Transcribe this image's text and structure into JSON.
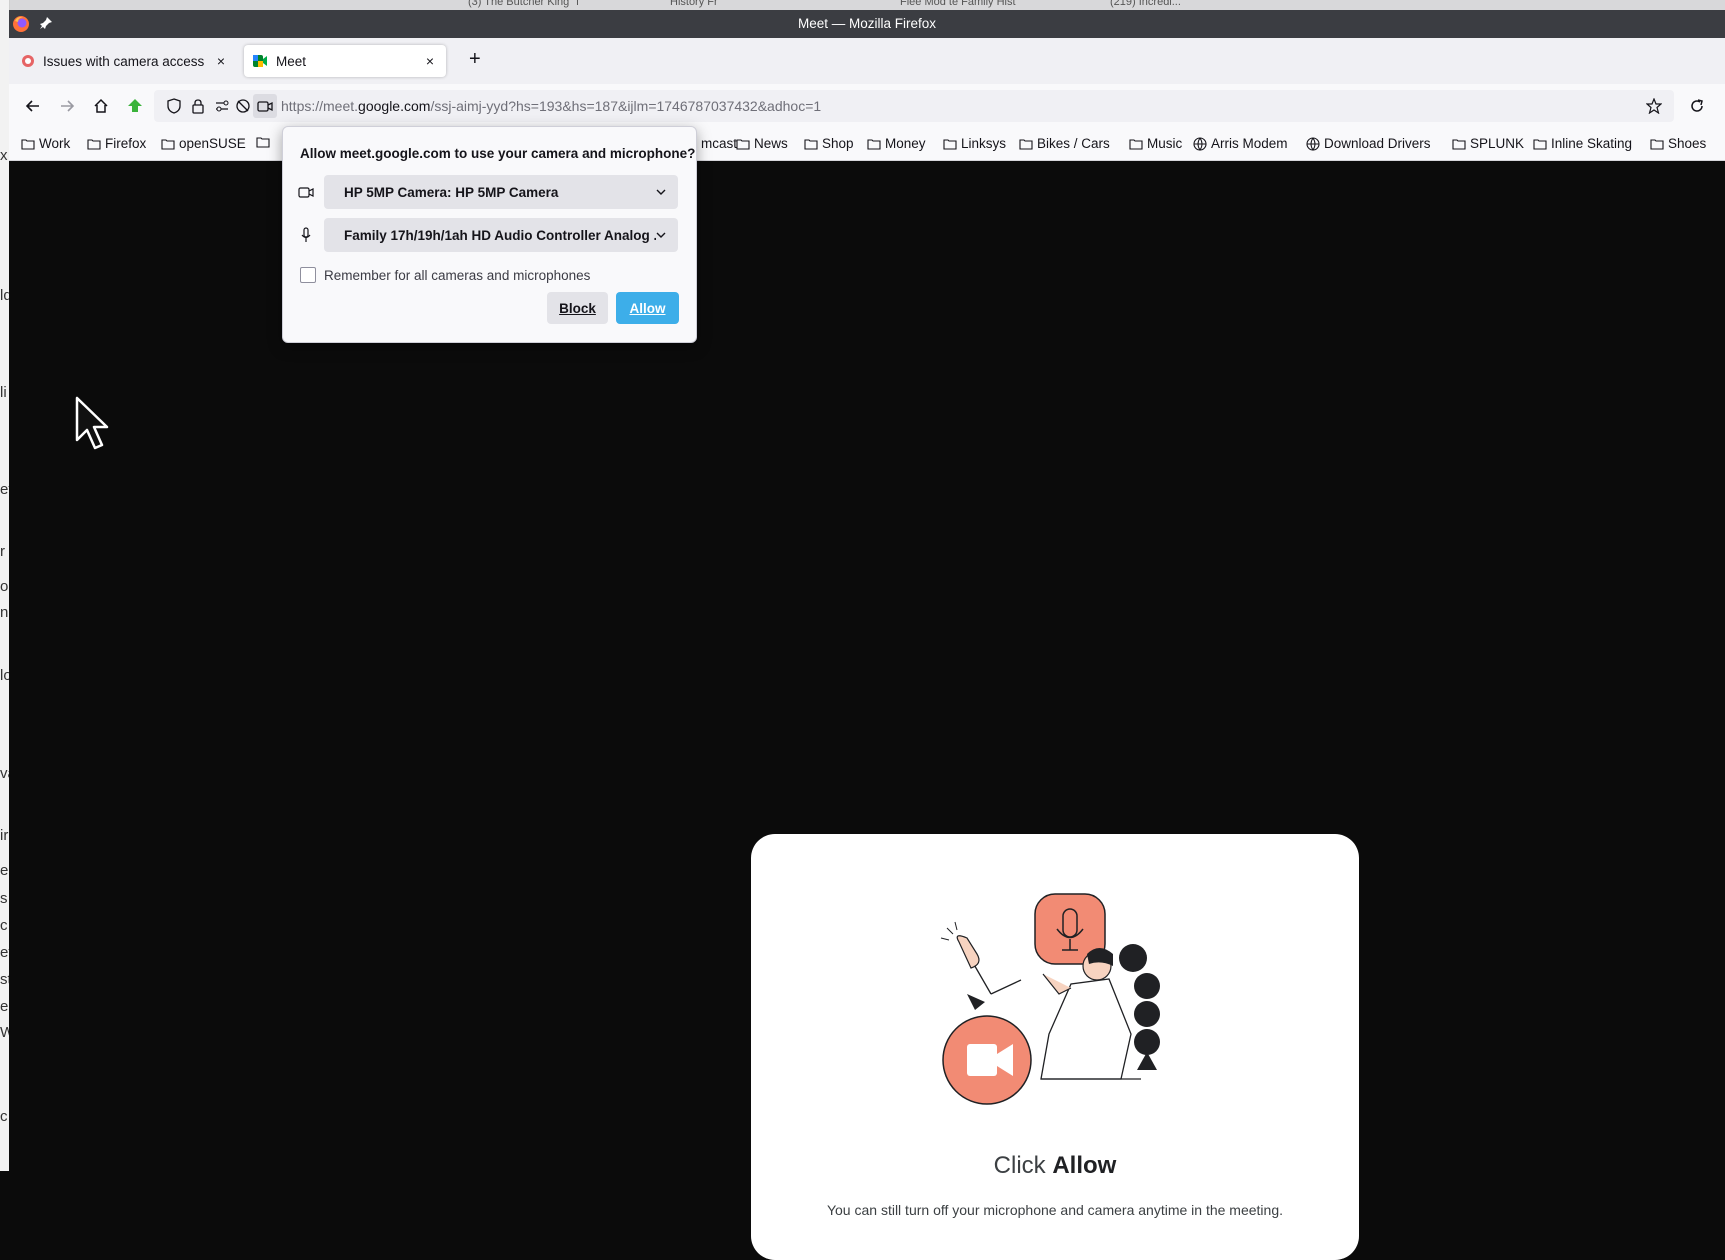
{
  "background_tabs": [
    {
      "label": "(3) The Butcher King \"i"
    },
    {
      "label": "History Fr"
    },
    {
      "label": "Flee Mod te Family Hist"
    },
    {
      "label": "(219) Incredi..."
    }
  ],
  "window": {
    "title": "Meet — Mozilla Firefox"
  },
  "tabs": [
    {
      "label": "Issues with camera access",
      "close": "×"
    },
    {
      "label": "Meet",
      "close": "×"
    }
  ],
  "new_tab": "+",
  "url": {
    "prefix": "https://meet.",
    "host": "google.com",
    "path": "/ssj-aimj-yyd?hs=193&hs=187&ijlm=1746787037432&adhoc=1"
  },
  "bookmarks": [
    {
      "label": "Work",
      "icon": "folder-icon"
    },
    {
      "label": "Firefox",
      "icon": "folder-icon"
    },
    {
      "label": "openSUSE",
      "icon": "folder-icon"
    },
    {
      "label": "mcast",
      "icon": "folder-icon"
    },
    {
      "label": "News",
      "icon": "folder-icon"
    },
    {
      "label": "Shop",
      "icon": "folder-icon"
    },
    {
      "label": "Money",
      "icon": "folder-icon"
    },
    {
      "label": "Linksys",
      "icon": "folder-icon"
    },
    {
      "label": "Bikes / Cars",
      "icon": "folder-icon"
    },
    {
      "label": "Music",
      "icon": "folder-icon"
    },
    {
      "label": "Arris Modem",
      "icon": "globe-icon"
    },
    {
      "label": "Download Drivers",
      "icon": "globe-icon"
    },
    {
      "label": "SPLUNK",
      "icon": "folder-icon"
    },
    {
      "label": "Inline Skating",
      "icon": "folder-icon"
    },
    {
      "label": "Shoes",
      "icon": "folder-icon"
    }
  ],
  "permission": {
    "title": "Allow meet.google.com to use your camera and microphone?",
    "camera": "HP 5MP Camera: HP 5MP Camera",
    "microphone": "Family 17h/19h/1ah HD Audio Controller Analog ...",
    "remember": "Remember for all cameras and microphones",
    "block": "Block",
    "allow": "Allow"
  },
  "meet_card": {
    "title_prefix": "Click ",
    "title_bold": "Allow",
    "subtitle": "You can still turn off your microphone and camera anytime in the meeting."
  },
  "behind_window_fragments": [
    "x",
    "ld",
    "li",
    "ef",
    "r",
    "o",
    "n",
    "lo",
    "va",
    "ir",
    "e",
    "s",
    "c",
    "et",
    "st",
    "ec",
    "W",
    "c"
  ],
  "colors": {
    "accent_allow": "#3daee9",
    "illustration_orange": "#f28b74",
    "titlebar": "#3b3d42"
  }
}
